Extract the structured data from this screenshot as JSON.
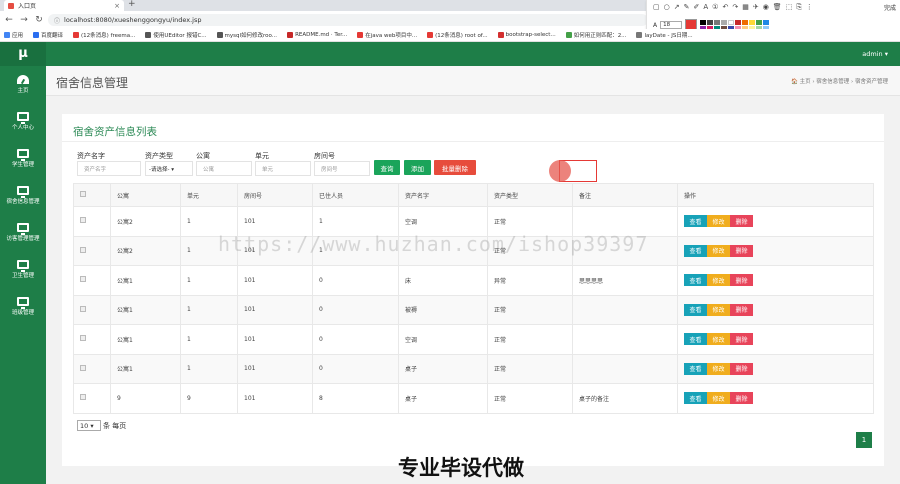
{
  "browser": {
    "tab_title": "入口页",
    "new_tab": "+",
    "url": "localhost:8080/xueshenggongyu/index.jsp",
    "bookmarks": [
      {
        "label": "应用",
        "color": "#4285f4"
      },
      {
        "label": "百度翻译",
        "color": "#2a6ef0"
      },
      {
        "label": "(12条消息) freema...",
        "color": "#e53935"
      },
      {
        "label": "使用UEditor 报错C...",
        "color": "#555555"
      },
      {
        "label": "mysql如何修改roo...",
        "color": "#555555"
      },
      {
        "label": "README.md · Ter...",
        "color": "#c62828"
      },
      {
        "label": "在java web项目中...",
        "color": "#e53935"
      },
      {
        "label": "(12条消息) root of...",
        "color": "#e53935"
      },
      {
        "label": "bootstrap-select...",
        "color": "#d32f2f"
      },
      {
        "label": "如何用正则匹配：2...",
        "color": "#43a047"
      },
      {
        "label": "layDate - JS日期...",
        "color": "#777777"
      }
    ],
    "ext_font_size": "18",
    "ext_done": "完成"
  },
  "header": {
    "logo": "μ",
    "user": "admin ▾"
  },
  "sidebar": {
    "items": [
      {
        "label": "主页",
        "icon": "dashboard-icon"
      },
      {
        "label": "个人中心",
        "icon": "monitor-icon"
      },
      {
        "label": "学生管理",
        "icon": "monitor-icon"
      },
      {
        "label": "宿舍信息管理",
        "icon": "monitor-icon"
      },
      {
        "label": "访客管理管理",
        "icon": "monitor-icon"
      },
      {
        "label": "卫生管理",
        "icon": "monitor-icon"
      },
      {
        "label": "班级管理",
        "icon": "monitor-icon"
      }
    ]
  },
  "page": {
    "title": "宿舍信息管理",
    "breadcrumb": "🏠 主页 › 宿舍信息管理 › 宿舍资产管理"
  },
  "panel": {
    "title": "宿舍资产信息列表",
    "filters": {
      "name_label": "资产名字",
      "name_placeholder": "资产名字",
      "type_label": "资产类型",
      "type_value": "-请选择- ▾",
      "building_label": "公寓",
      "building_placeholder": "公寓",
      "unit_label": "单元",
      "unit_placeholder": "单元",
      "room_label": "房间号",
      "room_placeholder": "房间号"
    },
    "buttons": {
      "search": "查询",
      "add": "添加",
      "batch_delete": "批量删除"
    },
    "table": {
      "headers": [
        "公寓",
        "单元",
        "房间号",
        "已住人员",
        "资产名字",
        "资产类型",
        "备注",
        "操作"
      ],
      "rows": [
        [
          "公寓2",
          "1",
          "101",
          "1",
          "空调",
          "正常",
          ""
        ],
        [
          "公寓2",
          "1",
          "101",
          "1",
          "",
          "正常",
          ""
        ],
        [
          "公寓1",
          "1",
          "101",
          "0",
          "床",
          "异常",
          "思思思思"
        ],
        [
          "公寓1",
          "1",
          "101",
          "0",
          "被褥",
          "正常",
          ""
        ],
        [
          "公寓1",
          "1",
          "101",
          "0",
          "空调",
          "正常",
          ""
        ],
        [
          "公寓1",
          "1",
          "101",
          "0",
          "桌子",
          "正常",
          ""
        ],
        [
          "9",
          "9",
          "101",
          "8",
          "桌子",
          "正常",
          "桌子的备注"
        ]
      ],
      "op_view": "查看",
      "op_edit": "修改",
      "op_delete": "删除"
    },
    "page_size": "10 ▾",
    "page_size_suffix": "条 每页",
    "current_page": "1"
  },
  "overlay": {
    "watermark": "https://www.huzhan.com/ishop39397",
    "banner": "专业毕设代做"
  }
}
